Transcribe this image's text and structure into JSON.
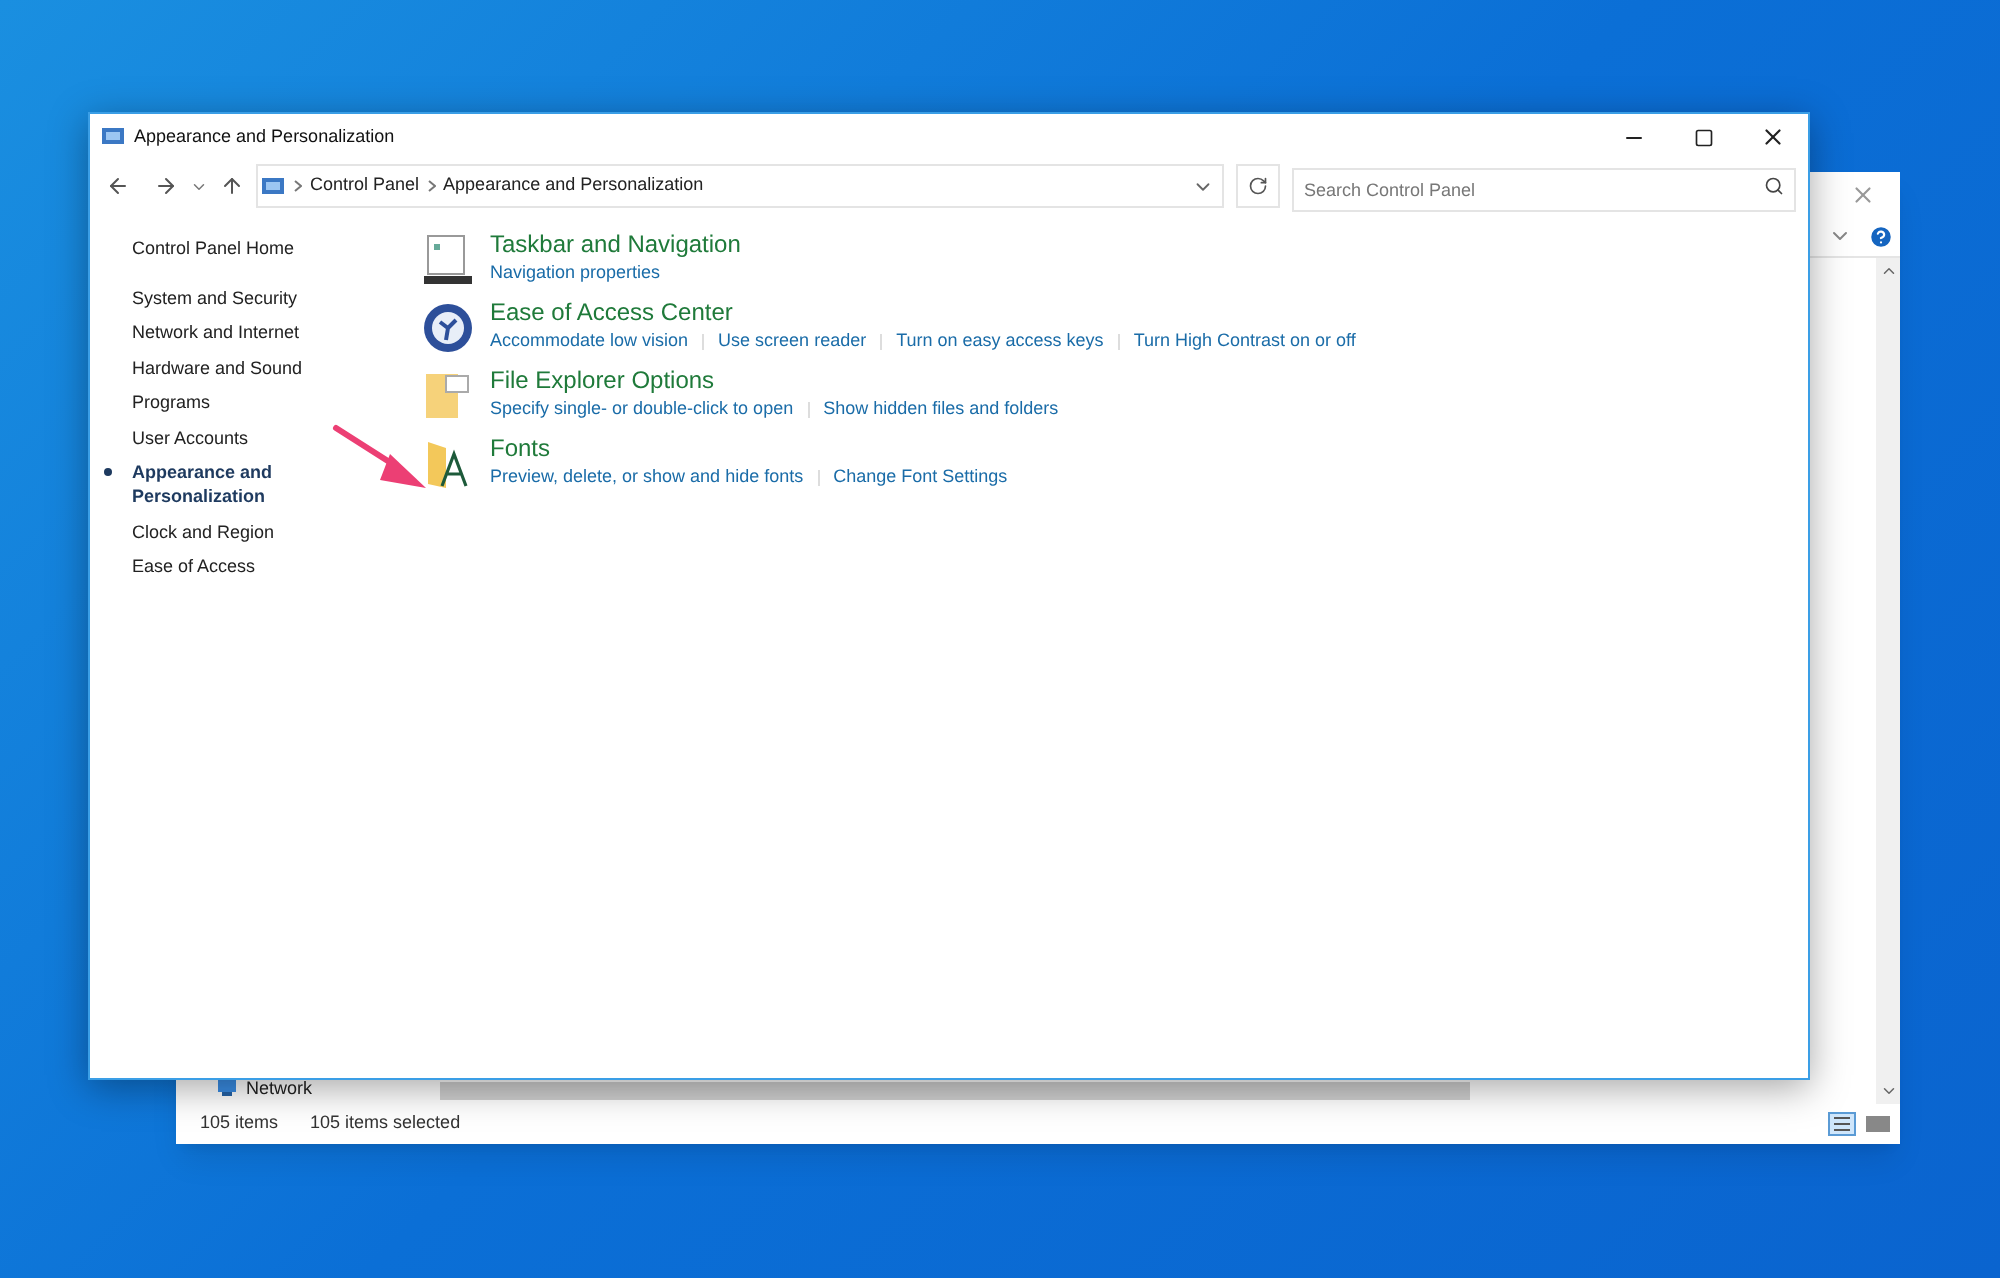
{
  "background_window": {
    "nav_item": "Network",
    "status_bar": [
      "105 items",
      "105 items selected"
    ]
  },
  "window": {
    "title": "Appearance and Personalization"
  },
  "address_bar": {
    "path": [
      "Control Panel",
      "Appearance and Personalization"
    ]
  },
  "search": {
    "placeholder": "Search Control Panel"
  },
  "sidebar": {
    "home": "Control Panel Home",
    "items": [
      {
        "label": "System and Security",
        "selected": false
      },
      {
        "label": "Network and Internet",
        "selected": false
      },
      {
        "label": "Hardware and Sound",
        "selected": false
      },
      {
        "label": "Programs",
        "selected": false
      },
      {
        "label": "User Accounts",
        "selected": false
      },
      {
        "label": "Appearance and Personalization",
        "selected": true
      },
      {
        "label": "Clock and Region",
        "selected": false
      },
      {
        "label": "Ease of Access",
        "selected": false
      }
    ]
  },
  "categories": [
    {
      "kind": "taskbar",
      "title": "Taskbar and Navigation",
      "links": [
        "Navigation properties"
      ]
    },
    {
      "kind": "ease",
      "title": "Ease of Access Center",
      "links": [
        "Accommodate low vision",
        "Use screen reader",
        "Turn on easy access keys",
        "Turn High Contrast on or off"
      ]
    },
    {
      "kind": "folder",
      "title": "File Explorer Options",
      "links": [
        "Specify single- or double-click to open",
        "Show hidden files and folders"
      ]
    },
    {
      "kind": "fonts",
      "title": "Fonts",
      "links": [
        "Preview, delete, or show and hide fonts",
        "Change Font Settings"
      ]
    }
  ]
}
